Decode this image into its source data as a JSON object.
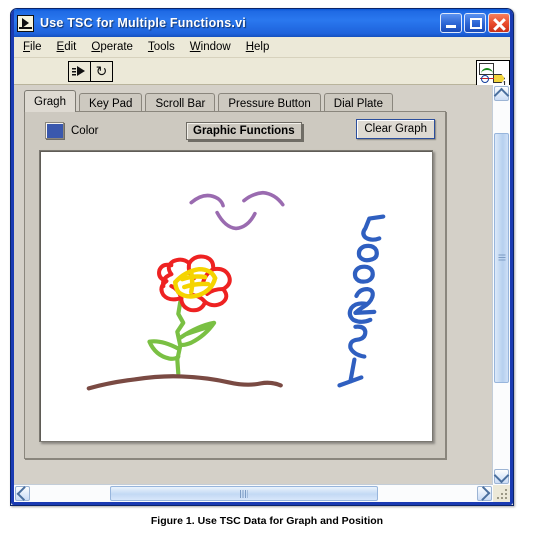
{
  "window": {
    "title": "Use TSC for Multiple Functions.vi",
    "icon": "labview-vi-icon",
    "minimize_label": "Minimize",
    "maximize_label": "Maximize",
    "close_label": "Close",
    "title_bar_color": "#1f6ae4"
  },
  "menubar": {
    "items": [
      {
        "label": "File",
        "accel": "F"
      },
      {
        "label": "Edit",
        "accel": "E"
      },
      {
        "label": "Operate",
        "accel": "O"
      },
      {
        "label": "Tools",
        "accel": "T"
      },
      {
        "label": "Window",
        "accel": "W"
      },
      {
        "label": "Help",
        "accel": "H"
      }
    ]
  },
  "toolbar": {
    "run_label": "Run",
    "run_continuously_label": "Run Continuously",
    "run_continuously_glyph": "↻",
    "vi_icon_number": "1"
  },
  "tabs": {
    "items": [
      {
        "label": "Gragh",
        "active": true
      },
      {
        "label": "Key Pad",
        "active": false
      },
      {
        "label": "Scroll Bar",
        "active": false
      },
      {
        "label": "Pressure Button",
        "active": false
      },
      {
        "label": "Dial Plate",
        "active": false
      }
    ]
  },
  "panel": {
    "color_label": "Color",
    "color_value": "#3a58ad",
    "graphic_functions_label": "Graphic Functions",
    "clear_graph_label": "Clear Graph"
  },
  "canvas": {
    "background": "#ffffff",
    "drawing_description": "Hand-drawn sketch: purple smiley face, red and yellow flower with green stem and leaves, brown ground line, blue rotated text TSC2005",
    "strokes": {
      "smiley_color": "#9a6bb0",
      "flower_petal_color": "#ee2222",
      "flower_center_color": "#f5d400",
      "stem_color": "#7ac043",
      "ground_color": "#7a4a43",
      "text_color": "#2f5fc0",
      "text_value": "TSC2005"
    }
  },
  "scrollbars": {
    "vertical_up_label": "Scroll up",
    "vertical_down_label": "Scroll down",
    "horizontal_left_label": "Scroll left",
    "horizontal_right_label": "Scroll right"
  },
  "caption": {
    "text": "Figure 1. Use TSC Data for Graph and Position"
  }
}
